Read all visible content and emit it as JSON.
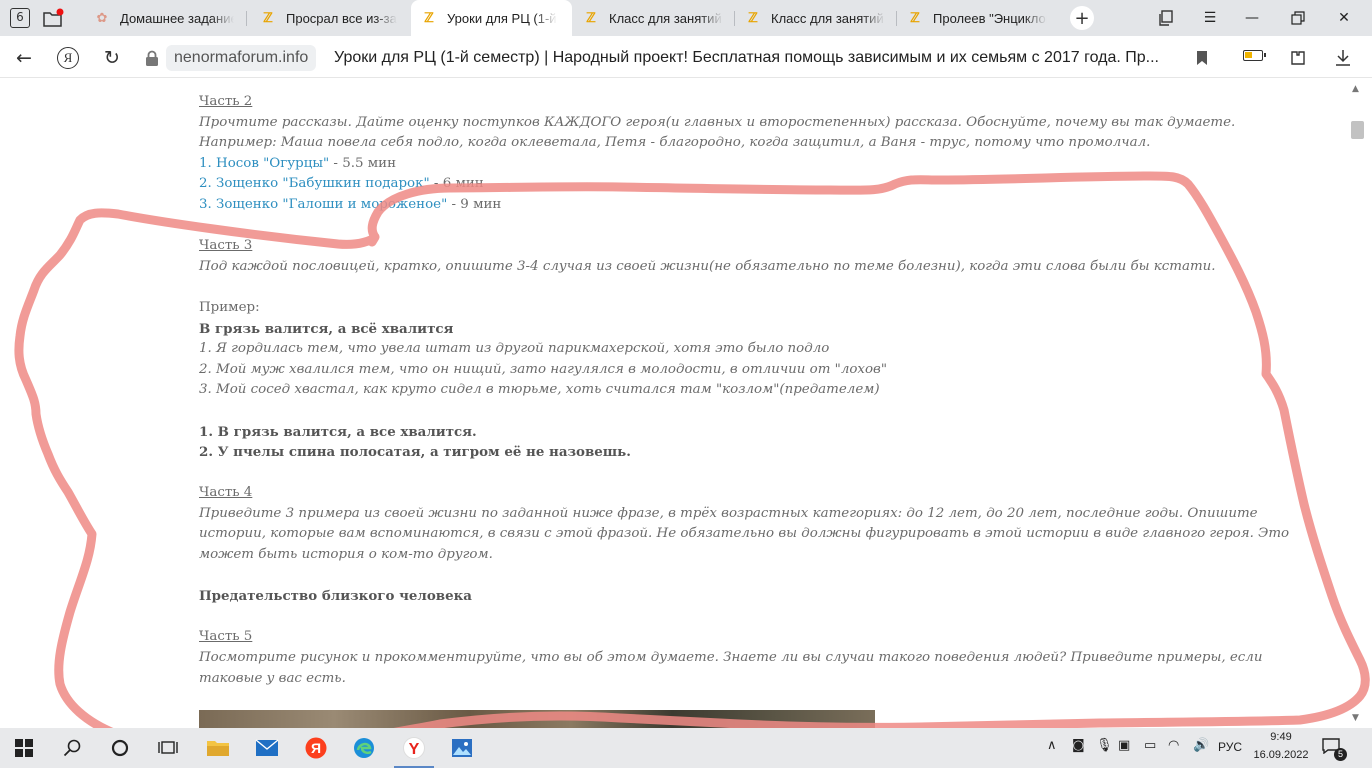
{
  "browser": {
    "tab_counter": "6",
    "tabs": [
      {
        "label": "Домашнее задание",
        "icon": "yandex-flower-icon",
        "active": false
      },
      {
        "label": "Просрал все из-за",
        "icon": "yandex-zen-icon",
        "active": false
      },
      {
        "label": "Уроки для РЦ (1-й",
        "icon": "yandex-zen-icon",
        "active": true
      },
      {
        "label": "Класс для занятий А",
        "icon": "yandex-zen-icon",
        "active": false
      },
      {
        "label": "Класс для занятий А",
        "icon": "yandex-zen-icon",
        "active": false
      },
      {
        "label": "Пролеев \"Энциклоп",
        "icon": "yandex-zen-icon",
        "active": false
      }
    ],
    "new_tab_label": "+",
    "ya_button_label": "Я",
    "domain": "nenormaforum.info",
    "page_title": "Уроки для РЦ (1-й семестр) | Народный проект! Бесплатная помощь зависимым и их семьям с 2017 года. Пр..."
  },
  "article": {
    "part2": {
      "heading": "Часть 2",
      "text": "Прочтите рассказы. Дайте оценку поступков КАЖДОГО героя(и главных и второстепенных) рассказа. Обоснуйте, почему вы так думаете. Например: Маша повела себя подло, когда оклеветала, Петя - благородно, когда защитил, а Ваня - трус, потому что промолчал.",
      "links": [
        {
          "title": "1. Носов \"Огурцы\"",
          "duration": " - 5.5 мин"
        },
        {
          "title": "2. Зощенко \"Бабушкин подарок\"",
          "duration": " - 6 мин"
        },
        {
          "title": "3. Зощенко \"Галоши и мороженое\"",
          "duration": " - 9 мин"
        }
      ]
    },
    "part3": {
      "heading": "Часть 3",
      "text": "Под каждой пословицей, кратко, опишите 3-4 случая из своей жизни(не обязательно по теме болезни), когда эти слова были бы кстати.",
      "example_label": "Пример:",
      "example_proverb": "В грязь валится, а всё хвалится",
      "example_items": [
        "1. Я гордилась тем, что увела штат из другой парикмахерской, хотя это было подло",
        "2. Мой муж хвалился тем, что он нищий, зато нагулялся в молодости, в отличии от \"лохов\"",
        "3. Мой сосед хвастал, как круто сидел в тюрьме, хоть считался там \"козлом\"(предателем)"
      ],
      "proverbs": [
        "1. В грязь валится, а все хвалится.",
        "2. У пчелы спина полосатая, а тигром её не назовешь."
      ]
    },
    "part4": {
      "heading": "Часть 4",
      "text": "Приведите 3 примера из своей жизни по заданной ниже фразе, в трёх возрастных категориях: до 12 лет, до 20 лет, последние годы. Опишите истории, которые вам вспоминаются, в связи с этой фразой. Не обязательно вы должны фигурировать в этой истории в виде главного героя. Это может быть история о ком-то другом.",
      "phrase": "Предательство близкого человека"
    },
    "part5": {
      "heading": "Часть 5",
      "text": "Посмотрите рисунок и прокомментируйте, что вы об этом думаете. Знаете ли вы случаи такого поведения людей? Приведите примеры, если таковые у вас есть."
    }
  },
  "taskbar": {
    "apps": [
      "start-icon",
      "search-icon",
      "cortana-icon",
      "task-view-icon",
      "file-explorer-icon",
      "mail-icon",
      "yandex-icon",
      "edge-icon",
      "yandex-browser-icon",
      "photos-icon"
    ],
    "language": "РУС",
    "time": "9:49",
    "date": "16.09.2022",
    "notification_count": "5"
  },
  "colors": {
    "link": "#2e8fc0",
    "text": "#6b6b6b",
    "scribble": "#ee8a85",
    "tabbar": "#e3e5e8",
    "taskbar": "#e8e9eb"
  }
}
